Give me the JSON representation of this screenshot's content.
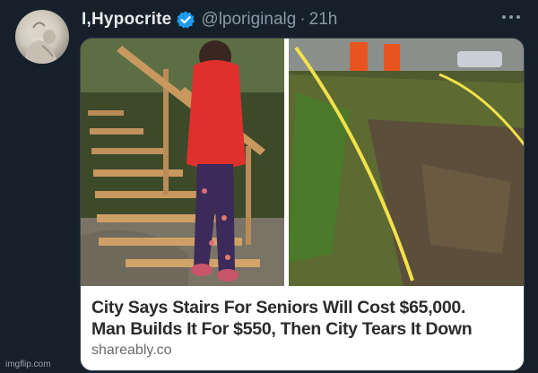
{
  "tweet": {
    "display_name": "I,Hypocrite",
    "handle": "@lporiginalg",
    "separator": "·",
    "time": "21h"
  },
  "card": {
    "headline_line1": "City Says Stairs For Seniors Will Cost $65,000.",
    "headline_line2": "Man Builds It For $550, Then City Tears It Down",
    "source": "shareably.co"
  },
  "watermark": "imgflip.com",
  "colors": {
    "background": "#15202b",
    "verified_badge": "#1d9bf0",
    "text_primary": "#e7e9ea",
    "text_secondary": "#8b98a5"
  },
  "icons": {
    "verified": "verified-badge-icon",
    "more": "more-options-icon"
  }
}
